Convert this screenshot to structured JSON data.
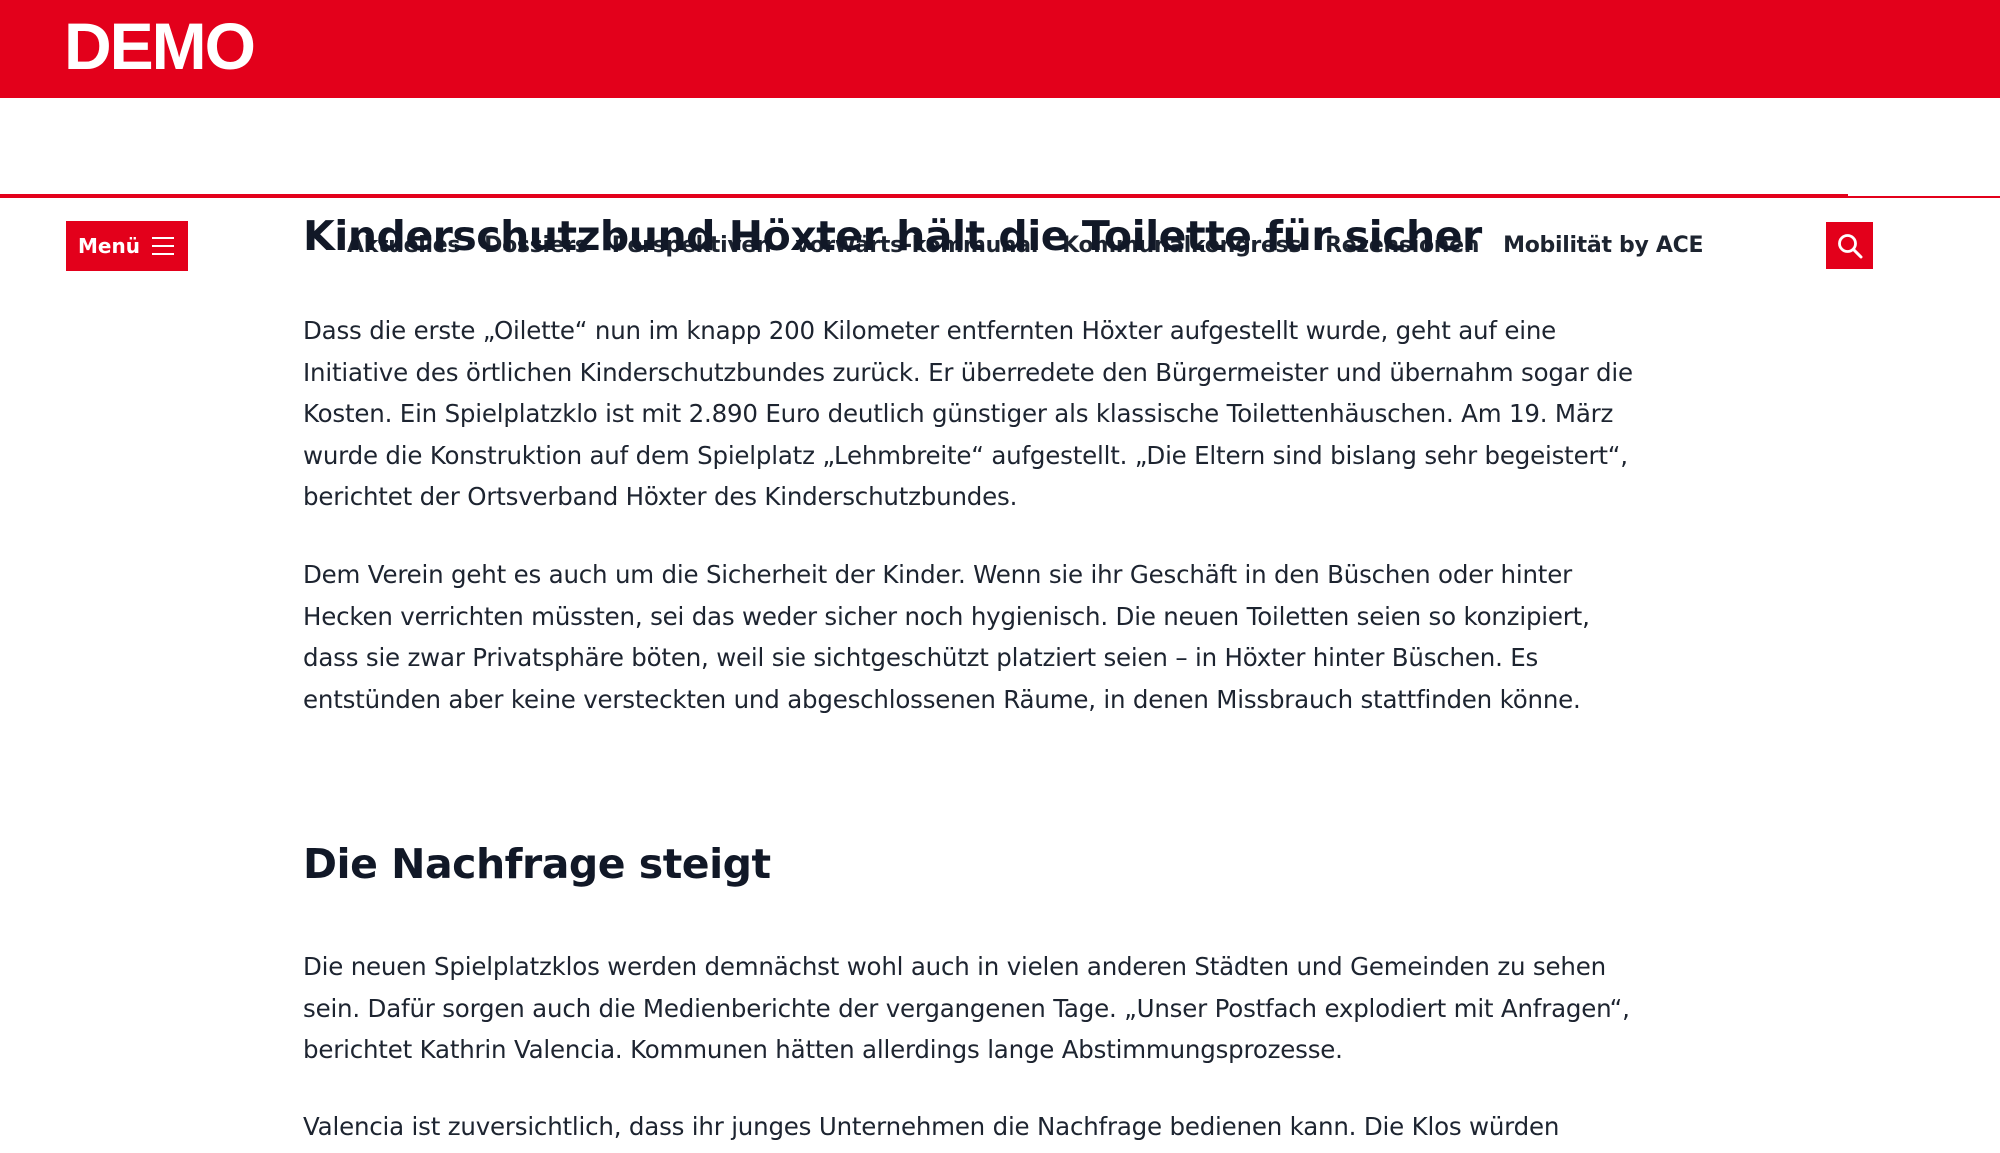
{
  "header": {
    "logo": "DEMO",
    "menu_label": "Menü",
    "nav_items": [
      {
        "label": "Aktuelles"
      },
      {
        "label": "Dossiers"
      },
      {
        "label": "Perspektiven"
      },
      {
        "label": "vorwärts-kommunal"
      },
      {
        "label": "Kommunalkongress"
      },
      {
        "label": "Rezensionen"
      },
      {
        "label": "Mobilität by ACE"
      }
    ],
    "search_icon": "search-icon",
    "menu_icon": "hamburger-icon"
  },
  "colors": {
    "brand_red": "#e3001b",
    "text": "#1d2430",
    "heading": "#111827",
    "background": "#ffffff"
  },
  "article": {
    "heading_1": "Kinderschutzbund Höxter hält die Toilette für sicher",
    "paragraph_1": "Dass die erste „Oilette“ nun im knapp 200 Kilometer entfernten Höxter aufgestellt wurde, geht auf eine Initiative des örtlichen Kinderschutzbundes zurück. Er überredete den Bürgermeister und übernahm sogar die Kosten. Ein Spielplatzklo ist mit 2.890 Euro deutlich günstiger als klassische Toilettenhäuschen. Am 19. März wurde die Konstruktion auf dem Spielplatz „Lehmbreite“ aufgestellt. „Die Eltern sind bislang sehr begeistert“, berichtet der Ortsverband Höxter des Kinderschutzbundes.",
    "paragraph_2": "Dem Verein geht es auch um die Sicherheit der Kinder. Wenn sie ihr Geschäft in den Büschen oder hinter Hecken verrichten müssten, sei das weder sicher noch hygienisch. Die neuen Toiletten seien so konzipiert, dass sie zwar Privatsphäre böten, weil sie sichtgeschützt platziert seien – in Höxter hinter Büschen. Es entstünden aber keine versteckten und abgeschlossenen Räume, in denen Missbrauch stattfinden könne.",
    "heading_2": "Die Nachfrage steigt",
    "paragraph_3": "Die neuen Spielplatzklos werden demnächst wohl auch in vielen anderen Städten und Gemeinden zu sehen sein. Dafür sorgen auch die Medienberichte der vergangenen Tage. „Unser Postfach explodiert mit Anfragen“, berichtet Kathrin Valencia. Kommunen hätten allerdings lange Abstimmungsprozesse.",
    "paragraph_4": "Valencia ist zuversichtlich, dass ihr junges Unternehmen die Nachfrage bedienen kann. Die Klos würden"
  }
}
